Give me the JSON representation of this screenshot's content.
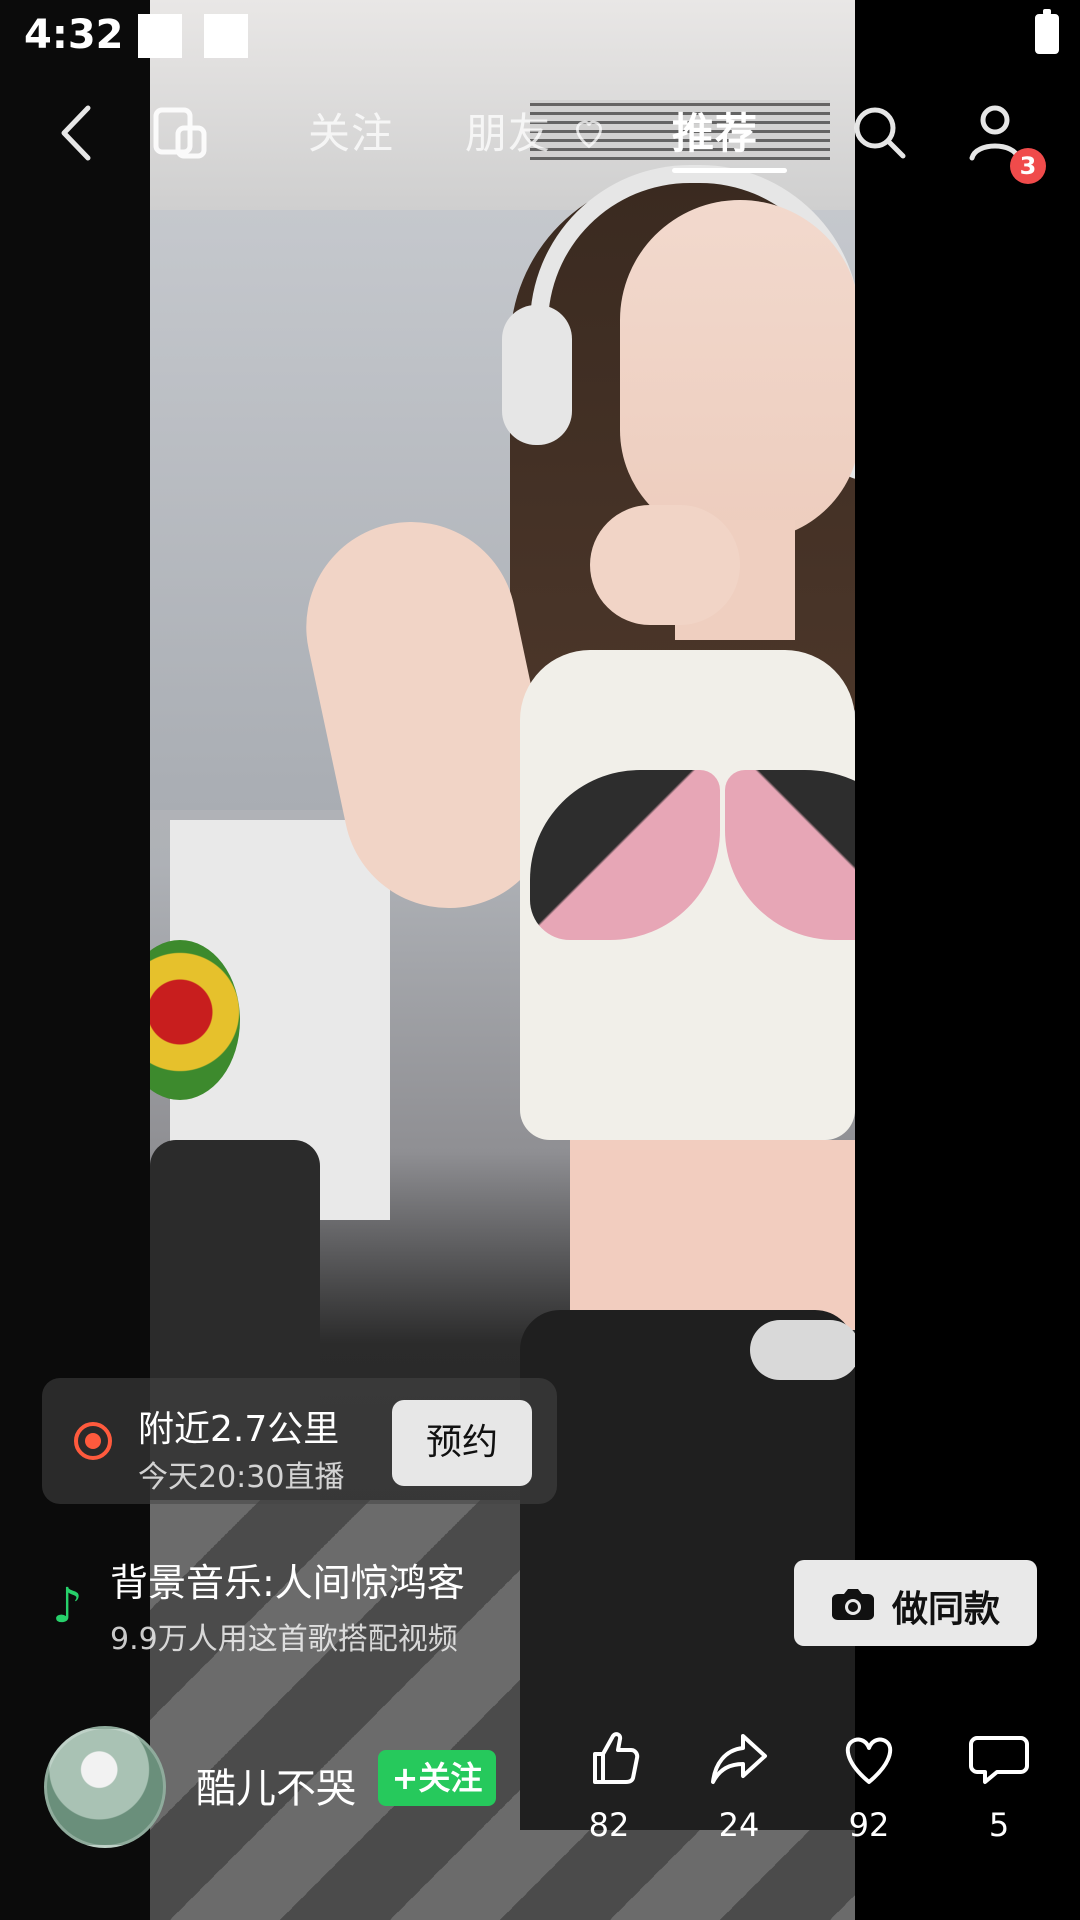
{
  "statusbar": {
    "time": "4:32"
  },
  "topnav": {
    "tabs": [
      {
        "label": "关注",
        "active": false
      },
      {
        "label": "朋友",
        "active": false
      },
      {
        "label": "推荐",
        "active": true
      }
    ],
    "notification_count": "3",
    "icons": [
      "back-icon",
      "devices-icon",
      "heart-icon",
      "search-icon",
      "profile-icon"
    ]
  },
  "live_card": {
    "title": "附近2.7公里",
    "subtitle": "今天20:30直播",
    "button_label": "预约",
    "accent": "#ff5a3d"
  },
  "music": {
    "title": "背景音乐:人间惊鸿客",
    "subtitle": "9.9万人用这首歌搭配视频",
    "icon": "music-note-icon",
    "accent": "#27d16b"
  },
  "make_same": {
    "label": "做同款",
    "icon": "camera-icon"
  },
  "author": {
    "name": "酷儿不哭",
    "follow_label": "+关注",
    "follow_color": "#26c95c"
  },
  "actions": {
    "like": {
      "count": "82",
      "icon": "thumbs-up-icon"
    },
    "share": {
      "count": "24",
      "icon": "share-icon"
    },
    "favorite": {
      "count": "92",
      "icon": "heart-icon"
    },
    "comment": {
      "count": "5",
      "icon": "comment-icon"
    }
  }
}
